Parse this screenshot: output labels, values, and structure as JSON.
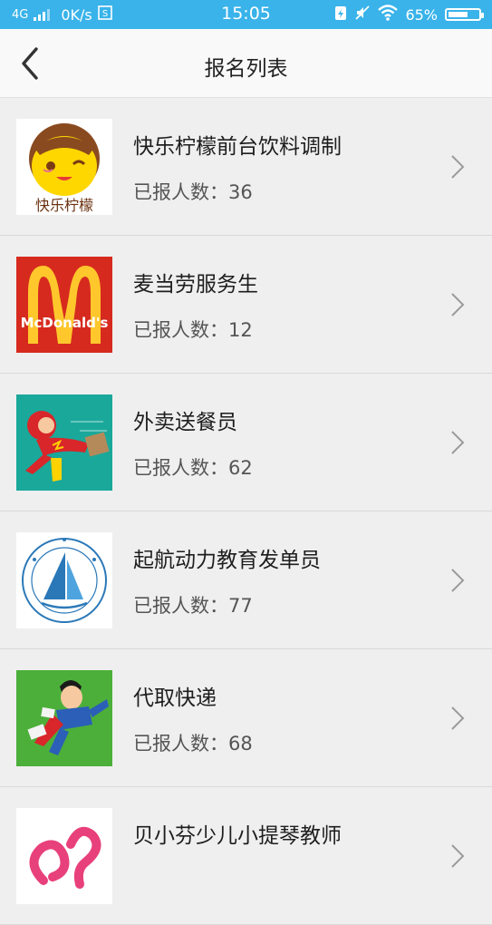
{
  "status_bar": {
    "network": "4G",
    "speed": "0K/s",
    "time": "15:05",
    "battery": "65%",
    "battery_level": 0.65
  },
  "header": {
    "title": "报名列表"
  },
  "items": [
    {
      "title": "快乐柠檬前台饮料调制",
      "count": "已报人数：36",
      "logo_text": "快乐柠檬",
      "icon": "happy-lemon-logo"
    },
    {
      "title": "麦当劳服务生",
      "count": "已报人数：12",
      "logo_text": "McDonald's",
      "icon": "mcdonalds-logo"
    },
    {
      "title": "外卖送餐员",
      "count": "已报人数：62",
      "icon": "flying-courier-logo"
    },
    {
      "title": "起航动力教育发单员",
      "count": "已报人数：77",
      "icon": "sailboat-education-logo"
    },
    {
      "title": "代取快递",
      "count": "已报人数：68",
      "icon": "superhero-delivery-logo"
    },
    {
      "title": "贝小芬少儿小提琴教师",
      "count": "",
      "icon": "pink-violin-logo"
    }
  ],
  "colors": {
    "status_bar": "#39b3ea",
    "list_bg": "#efefef",
    "mcdonalds_red": "#d62a1e",
    "mcdonalds_yellow": "#ffc72c",
    "courier_teal": "#1aa89a",
    "delivery_green": "#4caf3a"
  }
}
